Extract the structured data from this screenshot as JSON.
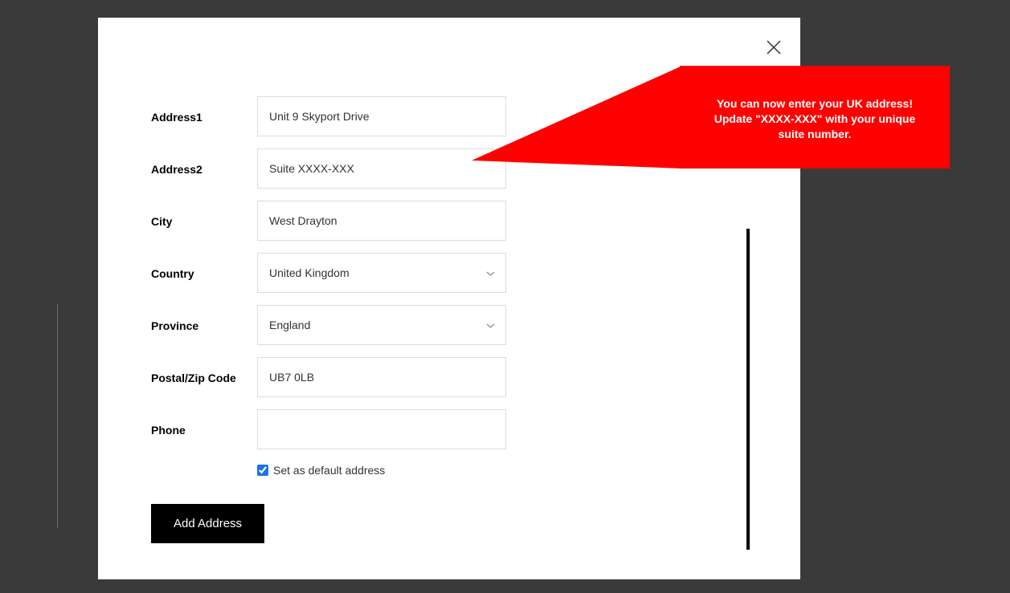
{
  "form": {
    "address1": {
      "label": "Address1",
      "value": "Unit 9 Skyport Drive"
    },
    "address2": {
      "label": "Address2",
      "value": "Suite XXXX-XXX"
    },
    "city": {
      "label": "City",
      "value": "West Drayton"
    },
    "country": {
      "label": "Country",
      "value": "United Kingdom"
    },
    "province": {
      "label": "Province",
      "value": "England"
    },
    "postal": {
      "label": "Postal/Zip Code",
      "value": "UB7 0LB"
    },
    "phone": {
      "label": "Phone",
      "value": ""
    },
    "default_checkbox_label": "Set as default address",
    "submit_label": "Add Address"
  },
  "callout": {
    "line1": "You can now enter your UK address!",
    "line2": "Update \"XXXX-XXX\" with your unique",
    "line3": "suite number."
  }
}
